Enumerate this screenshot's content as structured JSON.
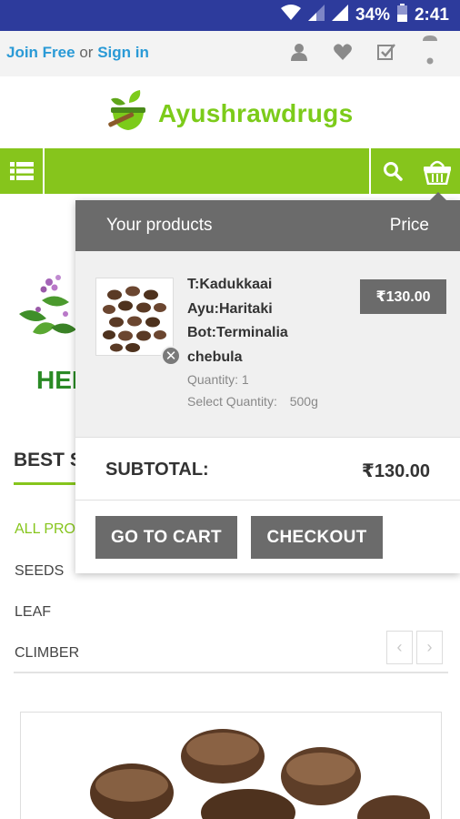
{
  "status_bar": {
    "battery": "34%",
    "time": "2:41"
  },
  "topbar": {
    "join": "Join Free",
    "or": "or",
    "signin": "Sign in"
  },
  "logo": {
    "text": "Ayushrawdrugs",
    "accent": "#7ccb1a"
  },
  "nav": {
    "color": "#86c51c"
  },
  "background": {
    "herbal_title": "HEI",
    "best_sellers": "BEST S",
    "categories": [
      "ALL PRO",
      "SEEDS",
      "LEAF",
      "CLIMBER"
    ],
    "prev_arrow": "‹",
    "next_arrow": "›"
  },
  "cart": {
    "header_left": "Your products",
    "header_right": "Price",
    "item": {
      "name_lines": [
        "T:Kadukkaai",
        "Ayu:Haritaki",
        "Bot:Terminalia",
        "chebula"
      ],
      "quantity": "Quantity: 1",
      "select_quantity_label": "Select Quantity:",
      "select_quantity_value": "500g",
      "price": "₹130.00",
      "remove": "✕"
    },
    "subtotal_label": "SUBTOTAL:",
    "subtotal_value": "₹130.00",
    "go_to_cart": "GO TO CART",
    "checkout": "CHECKOUT"
  }
}
